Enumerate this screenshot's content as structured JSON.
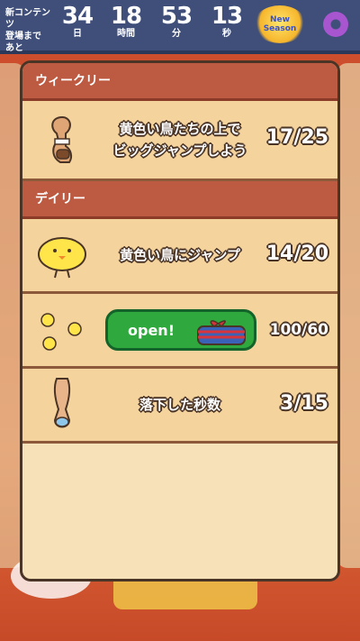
{
  "topbar": {
    "event_label_line1": "新コンテンツ",
    "event_label_line2": "登場まで",
    "event_label_line3": "あと",
    "countdown": [
      {
        "value": "34",
        "unit": "日"
      },
      {
        "value": "18",
        "unit": "時間"
      },
      {
        "value": "53",
        "unit": "分"
      },
      {
        "value": "13",
        "unit": "秒"
      }
    ],
    "season_logo_line1": "New",
    "season_logo_line2": "Season"
  },
  "panel": {
    "weekly_header": "ウィークリー",
    "daily_header": "デイリー",
    "weekly_mission": {
      "title_line1": "黄色い鳥たちの上で",
      "title_line2": "ビッグジャンプしよう",
      "progress": "17/25"
    },
    "daily_missions": [
      {
        "title": "黄色い鳥にジャンプ",
        "progress": "14/20"
      },
      {
        "button_label": "open!",
        "progress": "100/60"
      },
      {
        "title": "落下した秒数",
        "progress": "3/15"
      }
    ]
  },
  "colors": {
    "header": "#bd5b42",
    "row": "#f4d39d",
    "panel": "#f6e1b8",
    "open_button": "#2fa83e",
    "topbar": "#3f4f7a"
  }
}
